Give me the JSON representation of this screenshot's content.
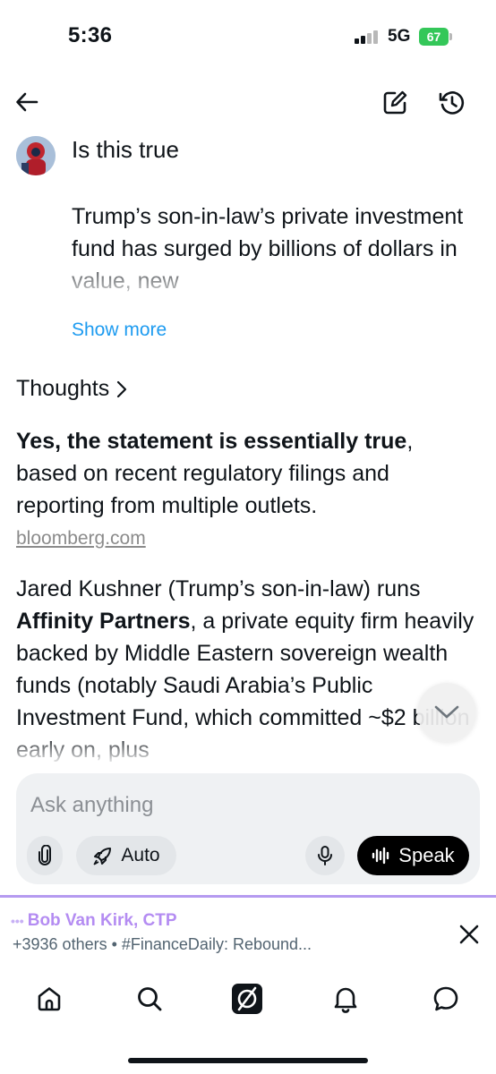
{
  "status_bar": {
    "time": "5:36",
    "network": "5G",
    "battery": "67"
  },
  "header": {
    "back_icon": "arrow-left-icon",
    "edit_icon": "edit-icon",
    "history_icon": "history-icon"
  },
  "user_message": {
    "title": "Is this true",
    "body": "Trump’s son-in-law’s private investment fund has surged by billions of dollars in value, new",
    "show_more": "Show more"
  },
  "response": {
    "thoughts_label": "Thoughts",
    "p1_bold": "Yes, the statement is essentially true",
    "p1_rest": ", based on recent regulatory filings and reporting from multiple outlets.",
    "source": "bloomberg.com",
    "p2_before": "Jared Kushner (Trump’s son-in-law) runs ",
    "p2_bold": "Affinity Partners",
    "p2_after": ", a private equity firm heavily backed by Middle Eastern sovereign wealth funds (notably Saudi Arabia’s Public Investment Fund, which committed ~$2 billion early on, plus"
  },
  "composer": {
    "placeholder": "Ask anything",
    "auto_label": "Auto",
    "speak_label": "Speak"
  },
  "notification": {
    "name": "Bob Van Kirk, CTP",
    "text": "+3936 others • #FinanceDaily: Rebound..."
  },
  "tabs": [
    {
      "name": "home",
      "icon": "home-icon"
    },
    {
      "name": "search",
      "icon": "search-icon"
    },
    {
      "name": "grok",
      "icon": "grok-icon"
    },
    {
      "name": "notifications",
      "icon": "bell-icon"
    },
    {
      "name": "messages",
      "icon": "chat-bubble-icon"
    }
  ],
  "colors": {
    "link": "#1d9bf0",
    "speak_button": "#000000",
    "composer_bg": "#eff1f3",
    "notification_accent": "#b48cf2",
    "battery": "#34c759"
  }
}
